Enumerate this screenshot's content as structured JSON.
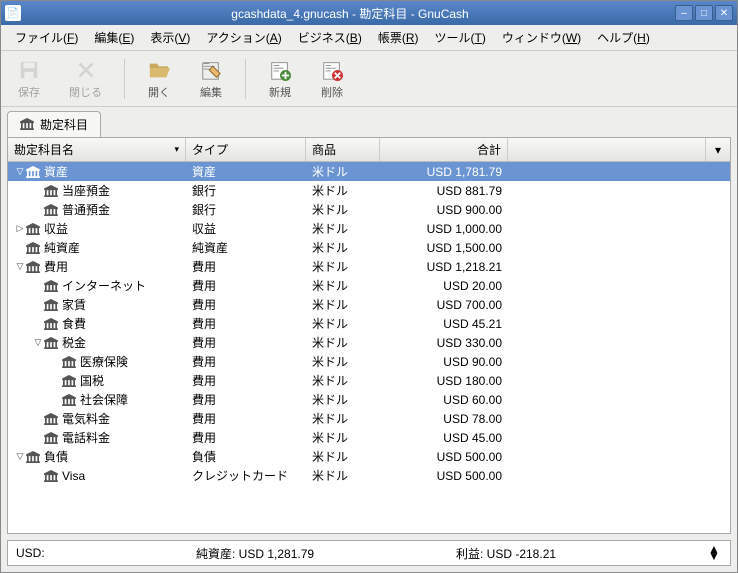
{
  "title": "gcashdata_4.gnucash - 勘定科目 - GnuCash",
  "menus": [
    {
      "label": "ファイル",
      "key": "F"
    },
    {
      "label": "編集",
      "key": "E"
    },
    {
      "label": "表示",
      "key": "V"
    },
    {
      "label": "アクション",
      "key": "A"
    },
    {
      "label": "ビジネス",
      "key": "B"
    },
    {
      "label": "帳票",
      "key": "R"
    },
    {
      "label": "ツール",
      "key": "T"
    },
    {
      "label": "ウィンドウ",
      "key": "W"
    },
    {
      "label": "ヘルプ",
      "key": "H"
    }
  ],
  "toolbar": {
    "save": "保存",
    "close": "閉じる",
    "open": "開く",
    "edit": "編集",
    "new": "新規",
    "delete": "削除"
  },
  "tab_label": "勘定科目",
  "columns": {
    "name": "勘定科目名",
    "type": "タイプ",
    "commodity": "商品",
    "total": "合計"
  },
  "rows": [
    {
      "depth": 0,
      "toggle": "open",
      "name": "資産",
      "type": "資産",
      "comm": "米ドル",
      "total": "USD 1,781.79",
      "selected": true
    },
    {
      "depth": 1,
      "toggle": "",
      "name": "当座預金",
      "type": "銀行",
      "comm": "米ドル",
      "total": "USD 881.79"
    },
    {
      "depth": 1,
      "toggle": "",
      "name": "普通預金",
      "type": "銀行",
      "comm": "米ドル",
      "total": "USD 900.00"
    },
    {
      "depth": 0,
      "toggle": "closed",
      "name": "収益",
      "type": "収益",
      "comm": "米ドル",
      "total": "USD 1,000.00"
    },
    {
      "depth": 0,
      "toggle": "",
      "name": "純資産",
      "type": "純資産",
      "comm": "米ドル",
      "total": "USD 1,500.00"
    },
    {
      "depth": 0,
      "toggle": "open",
      "name": "費用",
      "type": "費用",
      "comm": "米ドル",
      "total": "USD 1,218.21"
    },
    {
      "depth": 1,
      "toggle": "",
      "name": "インターネット",
      "type": "費用",
      "comm": "米ドル",
      "total": "USD 20.00"
    },
    {
      "depth": 1,
      "toggle": "",
      "name": "家賃",
      "type": "費用",
      "comm": "米ドル",
      "total": "USD 700.00"
    },
    {
      "depth": 1,
      "toggle": "",
      "name": "食費",
      "type": "費用",
      "comm": "米ドル",
      "total": "USD 45.21"
    },
    {
      "depth": 1,
      "toggle": "open",
      "name": "税金",
      "type": "費用",
      "comm": "米ドル",
      "total": "USD 330.00"
    },
    {
      "depth": 2,
      "toggle": "",
      "name": "医療保険",
      "type": "費用",
      "comm": "米ドル",
      "total": "USD 90.00"
    },
    {
      "depth": 2,
      "toggle": "",
      "name": "国税",
      "type": "費用",
      "comm": "米ドル",
      "total": "USD 180.00"
    },
    {
      "depth": 2,
      "toggle": "",
      "name": "社会保障",
      "type": "費用",
      "comm": "米ドル",
      "total": "USD 60.00"
    },
    {
      "depth": 1,
      "toggle": "",
      "name": "電気料金",
      "type": "費用",
      "comm": "米ドル",
      "total": "USD 78.00"
    },
    {
      "depth": 1,
      "toggle": "",
      "name": "電話料金",
      "type": "費用",
      "comm": "米ドル",
      "total": "USD 45.00"
    },
    {
      "depth": 0,
      "toggle": "open",
      "name": "負債",
      "type": "負債",
      "comm": "米ドル",
      "total": "USD 500.00"
    },
    {
      "depth": 1,
      "toggle": "",
      "name": "Visa",
      "type": "クレジットカード",
      "comm": "米ドル",
      "total": "USD 500.00"
    }
  ],
  "status": {
    "currency": "USD:",
    "net_assets": "純資産: USD 1,281.79",
    "profit": "利益: USD -218.21"
  }
}
